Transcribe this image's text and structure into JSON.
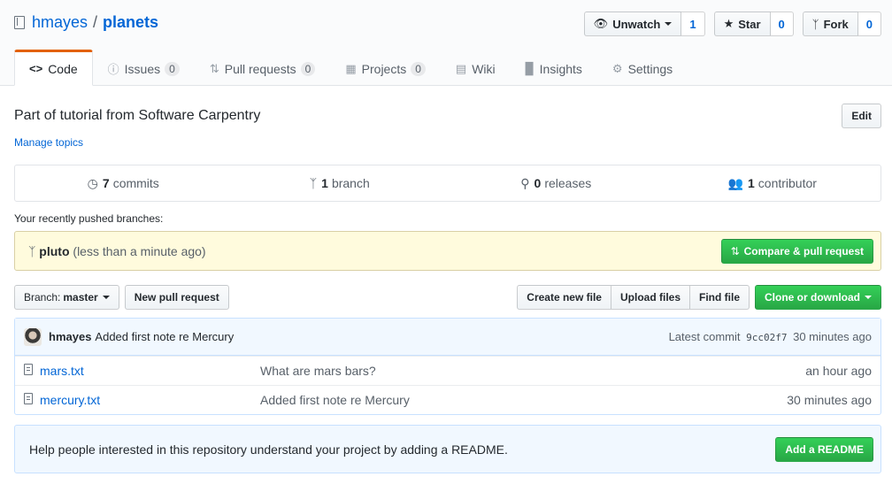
{
  "repo": {
    "owner": "hmayes",
    "separator": "/",
    "name": "planets"
  },
  "actions": {
    "watch": {
      "label": "Unwatch",
      "count": "1"
    },
    "star": {
      "label": "Star",
      "count": "0"
    },
    "fork": {
      "label": "Fork",
      "count": "0"
    }
  },
  "tabs": [
    {
      "label": "Code",
      "count": null,
      "icon": "code-icon",
      "selected": true
    },
    {
      "label": "Issues",
      "count": "0",
      "icon": "issue-icon"
    },
    {
      "label": "Pull requests",
      "count": "0",
      "icon": "pull-request-icon"
    },
    {
      "label": "Projects",
      "count": "0",
      "icon": "project-icon"
    },
    {
      "label": "Wiki",
      "count": null,
      "icon": "book-icon"
    },
    {
      "label": "Insights",
      "count": null,
      "icon": "graph-icon"
    },
    {
      "label": "Settings",
      "count": null,
      "icon": "gear-icon"
    }
  ],
  "description": "Part of tutorial from Software Carpentry",
  "edit_label": "Edit",
  "manage_topics": "Manage topics",
  "summary": {
    "commits": {
      "num": "7",
      "label": "commits"
    },
    "branches": {
      "num": "1",
      "label": "branch"
    },
    "releases": {
      "num": "0",
      "label": "releases"
    },
    "contributors": {
      "num": "1",
      "label": "contributor"
    }
  },
  "recent": {
    "label": "Your recently pushed branches:",
    "branch": "pluto",
    "when": "(less than a minute ago)",
    "compare_label": "Compare & pull request"
  },
  "file_nav": {
    "branch_prefix": "Branch:",
    "branch_name": "master",
    "new_pr": "New pull request",
    "create_file": "Create new file",
    "upload": "Upload files",
    "find": "Find file",
    "clone": "Clone or download"
  },
  "latest_commit": {
    "author": "hmayes",
    "message": "Added first note re Mercury",
    "prefix": "Latest commit",
    "sha": "9cc02f7",
    "ago": "30 minutes ago"
  },
  "files": [
    {
      "name": "mars.txt",
      "message": "What are mars bars?",
      "age": "an hour ago"
    },
    {
      "name": "mercury.txt",
      "message": "Added first note re Mercury",
      "age": "30 minutes ago"
    }
  ],
  "readme": {
    "text": "Help people interested in this repository understand your project by adding a README.",
    "button": "Add a README"
  },
  "colors": {
    "accent": "#0366d6",
    "primary_button": "#28a745",
    "tab_underline": "#e36209",
    "flash_bg": "#fffbdd"
  }
}
